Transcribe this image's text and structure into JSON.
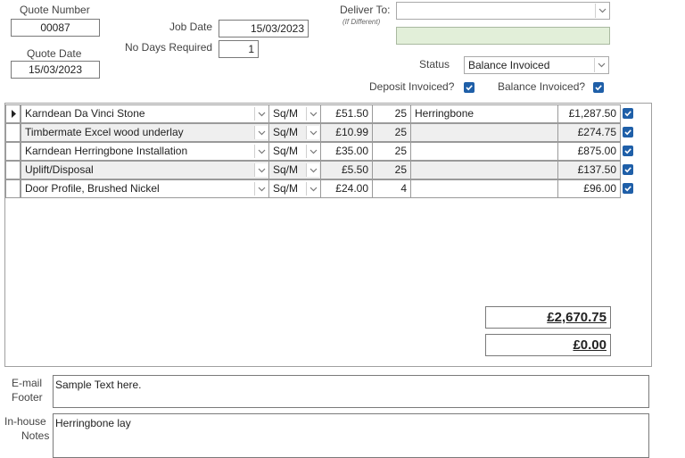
{
  "header": {
    "quote_number_label": "Quote Number",
    "quote_number": "00087",
    "quote_date_label": "Quote Date",
    "quote_date": "15/03/2023",
    "job_date_label": "Job Date",
    "job_date": "15/03/2023",
    "no_days_label": "No Days Required",
    "no_days": "1",
    "deliver_to_label": "Deliver To:",
    "deliver_to_sub": "(If Different)",
    "deliver_to_value": "",
    "status_label": "Status",
    "status_value": "Balance Invoiced",
    "deposit_invoiced_label": "Deposit Invoiced?",
    "balance_invoiced_label": "Balance Invoiced?"
  },
  "lines": [
    {
      "product": "Karndean Da Vinci Stone",
      "unit": "Sq/M",
      "price": "£51.50",
      "qty": "25",
      "note": "Herringbone",
      "total": "£1,287.50"
    },
    {
      "product": "Timbermate Excel wood underlay",
      "unit": "Sq/M",
      "price": "£10.99",
      "qty": "25",
      "note": "",
      "total": "£274.75"
    },
    {
      "product": "Karndean Herringbone Installation",
      "unit": "Sq/M",
      "price": "£35.00",
      "qty": "25",
      "note": "",
      "total": "£875.00"
    },
    {
      "product": "Uplift/Disposal",
      "unit": "Sq/M",
      "price": "£5.50",
      "qty": "25",
      "note": "",
      "total": "£137.50"
    },
    {
      "product": "Door Profile, Brushed Nickel",
      "unit": "Sq/M",
      "price": "£24.00",
      "qty": "4",
      "note": "",
      "total": "£96.00"
    }
  ],
  "totals": {
    "grand_total": "£2,670.75",
    "balance": "£0.00"
  },
  "footer": {
    "email_footer_label_1": "E-mail",
    "email_footer_label_2": "Footer",
    "email_footer_value": "Sample Text here.",
    "inhouse_label_1": "In-house",
    "inhouse_label_2": "Notes",
    "inhouse_value": "Herringbone lay"
  },
  "colors": {
    "accent": "#1f5fa8",
    "green_field": "#e2efd9",
    "alt_row": "#efefef"
  }
}
